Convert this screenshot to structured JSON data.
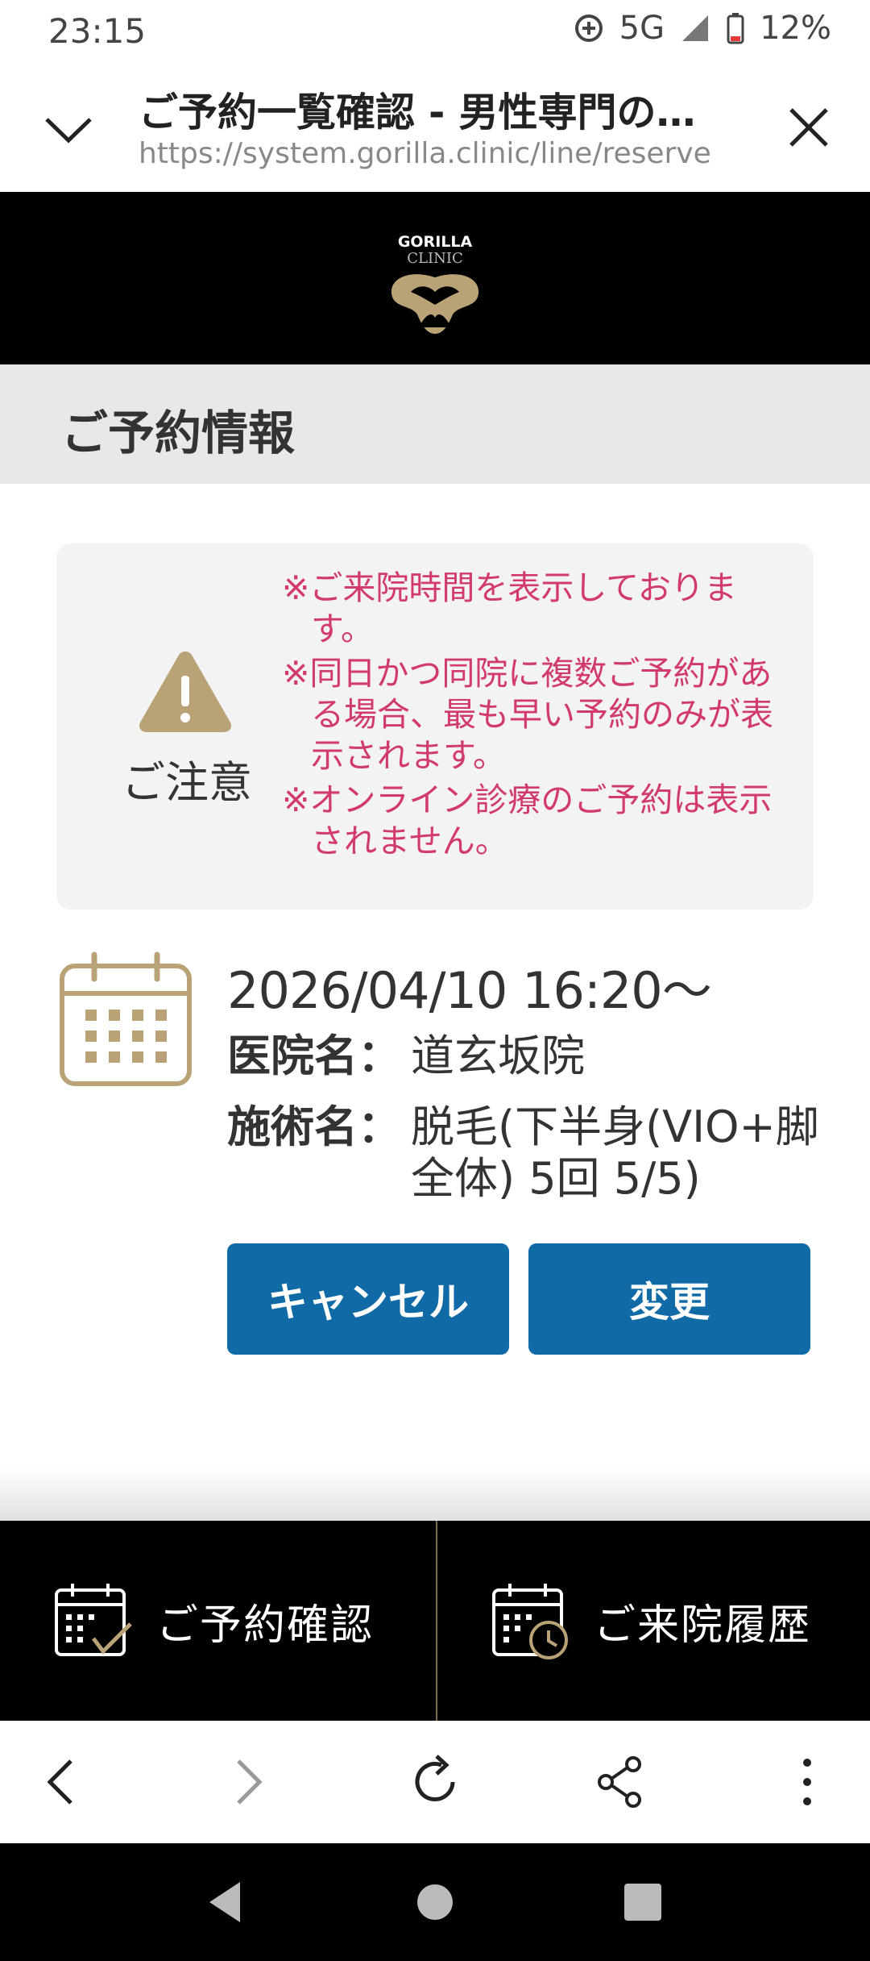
{
  "status_bar": {
    "time": "23:15",
    "network": "5G",
    "battery": "12%"
  },
  "browser": {
    "page_title": "ご予約一覧確認 - 男性専門の…",
    "url": "https://system.gorilla.clinic/line/reserve"
  },
  "site": {
    "logo_line1": "GORILLA",
    "logo_line2": "CLINIC"
  },
  "section": {
    "heading": "ご予約情報"
  },
  "notice": {
    "label": "ご注意",
    "items": [
      "※ご来院時間を表示しております。",
      "※同日かつ同院に複数ご予約がある場合、最も早い予約のみが表示されます。",
      "※オンライン診療のご予約は表示されません。"
    ]
  },
  "reservation": {
    "datetime": "2026/04/10 16:20〜",
    "clinic_label": "医院名：",
    "clinic_value": "道玄坂院",
    "treatment_label": "施術名：",
    "treatment_value": "脱毛(下半身(VIO+脚全体) 5回 5/5)",
    "cancel_label": "キャンセル",
    "change_label": "変更"
  },
  "bottom_nav": {
    "items": [
      {
        "label": "ご予約確認",
        "icon": "calendar-check-icon"
      },
      {
        "label": "ご来院履歴",
        "icon": "calendar-history-icon"
      }
    ]
  },
  "colors": {
    "accent_gold": "#b9a276",
    "notice_text": "#d23a6e",
    "button_blue": "#0f6aa6"
  }
}
